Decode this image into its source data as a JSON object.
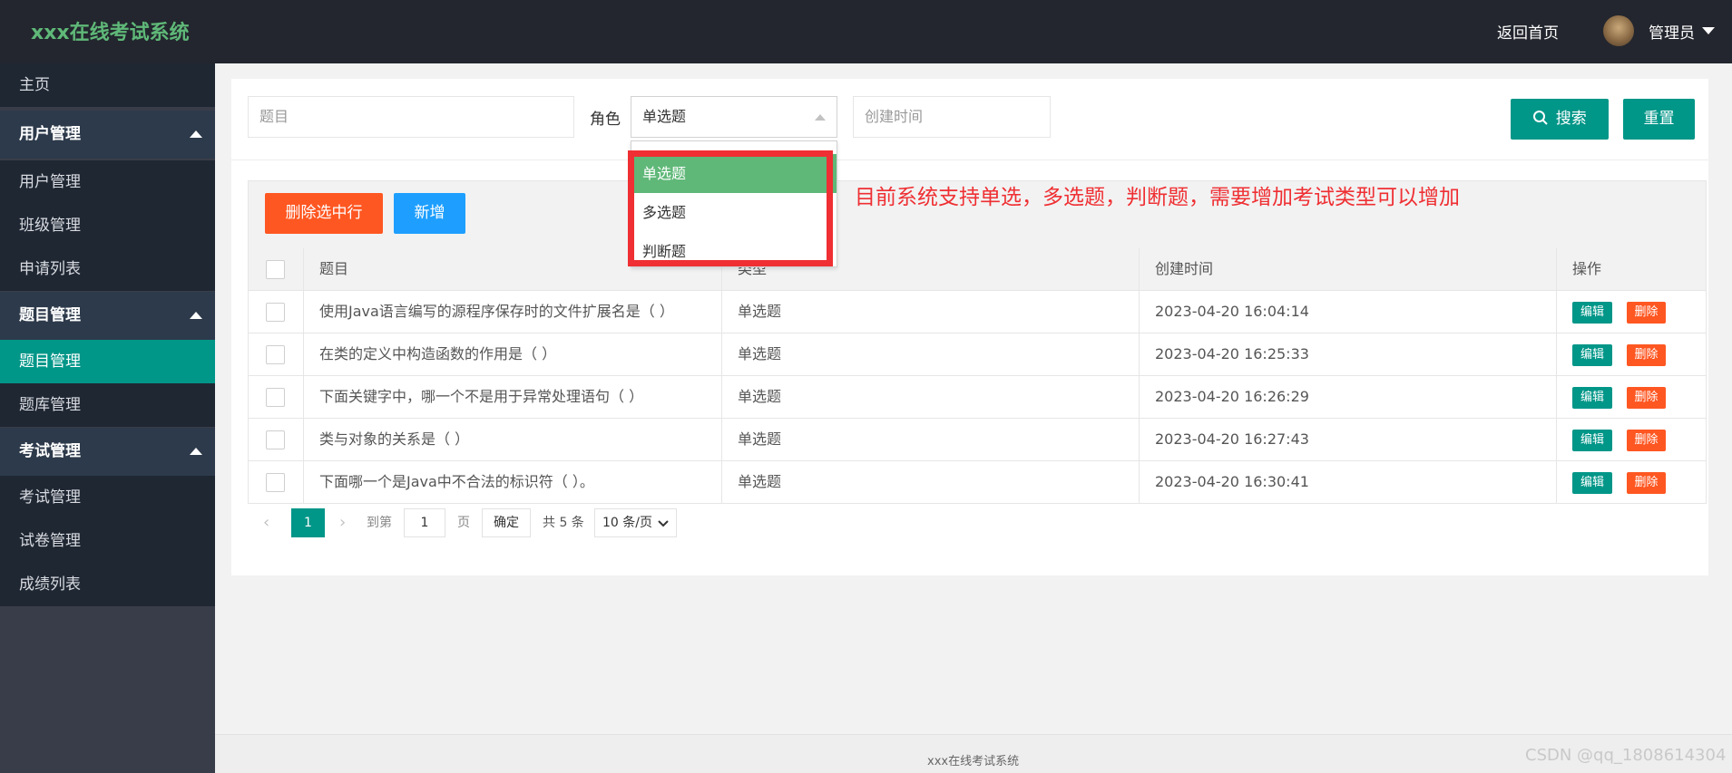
{
  "header": {
    "app_title": "xxx在线考试系统",
    "home_link": "返回首页",
    "user_name": "管理员"
  },
  "sidebar": {
    "home": "主页",
    "groups": [
      {
        "label": "用户管理",
        "items": [
          "用户管理",
          "班级管理",
          "申请列表"
        ]
      },
      {
        "label": "题目管理",
        "items": [
          "题目管理",
          "题库管理"
        ]
      },
      {
        "label": "考试管理",
        "items": [
          "考试管理",
          "试卷管理",
          "成绩列表"
        ]
      }
    ],
    "active_item": "题目管理"
  },
  "search": {
    "title_placeholder": "题目",
    "role_label": "角色",
    "role_value": "单选题",
    "created_placeholder": "创建时间",
    "search_button": "搜索",
    "reset_button": "重置"
  },
  "dropdown": {
    "options": [
      "单选题",
      "多选题",
      "判断题"
    ],
    "selected": "单选题"
  },
  "annotation": "目前系统支持单选，多选题，判断题，需要增加考试类型可以增加",
  "toolbar": {
    "delete_selected": "删除选中行",
    "add": "新增"
  },
  "table": {
    "columns": [
      "题目",
      "类型",
      "创建时间",
      "操作"
    ],
    "rows": [
      {
        "title": "使用Java语言编写的源程序保存时的文件扩展名是（ ）",
        "type": "单选题",
        "created": "2023-04-20 16:04:14"
      },
      {
        "title": "在类的定义中构造函数的作用是（ ）",
        "type": "单选题",
        "created": "2023-04-20 16:25:33"
      },
      {
        "title": "下面关键字中，哪一个不是用于异常处理语句（ ）",
        "type": "单选题",
        "created": "2023-04-20 16:26:29"
      },
      {
        "title": "类与对象的关系是（ ）",
        "type": "单选题",
        "created": "2023-04-20 16:27:43"
      },
      {
        "title": "下面哪一个是Java中不合法的标识符（ ）。",
        "type": "单选题",
        "created": "2023-04-20 16:30:41"
      }
    ],
    "edit_label": "编辑",
    "delete_label": "删除"
  },
  "pagination": {
    "current_page": "1",
    "goto_label": "到第",
    "goto_value": "1",
    "page_unit": "页",
    "confirm": "确定",
    "total": "共 5 条",
    "page_size": "10 条/页"
  },
  "footer": {
    "text": "xxx在线考试系统",
    "watermark": "CSDN @qq_1808614304"
  },
  "colors": {
    "header_bg": "#23262e",
    "sidebar_bg": "#1f2733",
    "accent": "#009688",
    "logo": "#5fb878",
    "danger": "#ff5722",
    "primary": "#1e9fff",
    "annotation_red": "#ef2f33"
  }
}
